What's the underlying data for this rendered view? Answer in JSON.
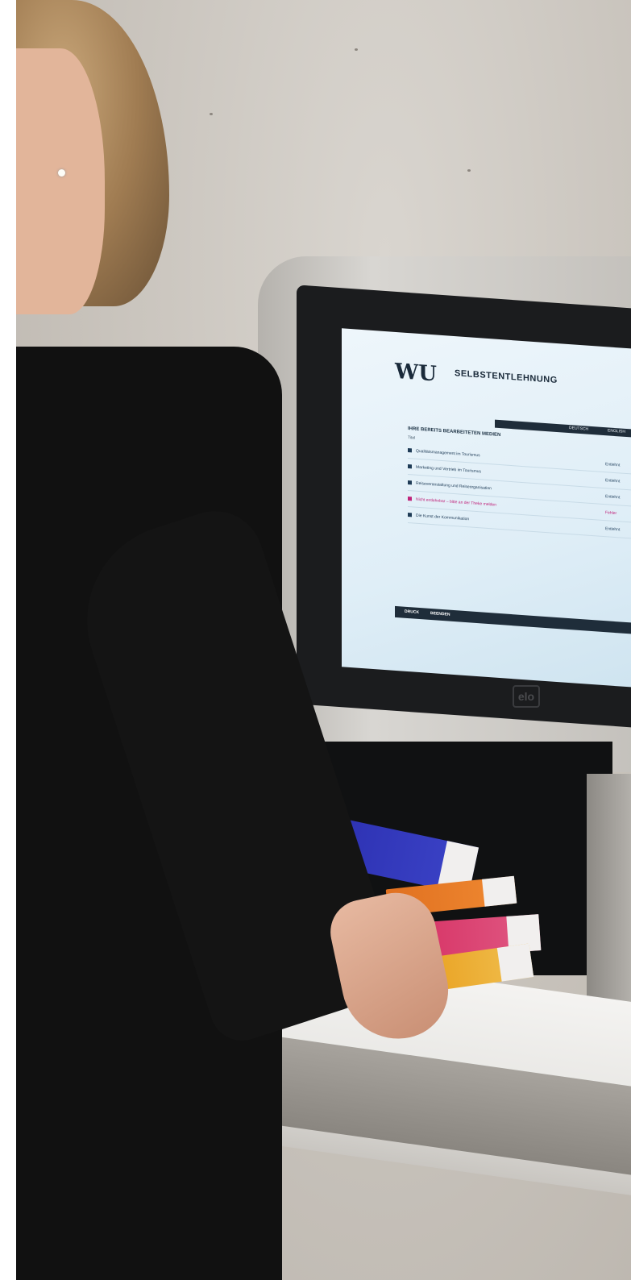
{
  "kiosk": {
    "logo": "WU",
    "title": "SELBSTENTLEHNUNG",
    "tabs": [
      "DEUTSCH",
      "ENGLISH"
    ],
    "panel_header": "IHRE BEREITS BEARBEITETEN MEDIEN",
    "column_title": "Titel",
    "column_status": "Status",
    "items": [
      {
        "title": "Qualitätsmanagement im Tourismus",
        "status": "Entlehnt",
        "warning": false
      },
      {
        "title": "Marketing und Vertrieb im Tourismus",
        "status": "Entlehnt",
        "warning": false
      },
      {
        "title": "Reiseveranstaltung und Reiseorganisation",
        "status": "Entlehnt",
        "warning": false
      },
      {
        "title": "Nicht entlehnbar – bitte an der Theke melden",
        "status": "Fehler",
        "warning": true
      },
      {
        "title": "Die Kunst der Kommunikation",
        "status": "Entlehnt",
        "warning": false
      }
    ],
    "footer_buttons": [
      "DRUCK",
      "BEENDEN"
    ],
    "brand_mark": "elo"
  },
  "colors": {
    "screen_bg": "#dfeef7",
    "navy": "#1f2d3a",
    "warning": "#c0237a"
  }
}
